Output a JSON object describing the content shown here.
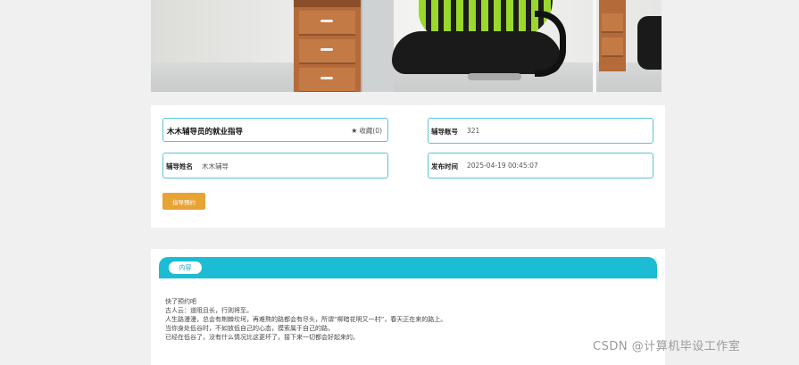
{
  "detail": {
    "title": "木木辅导员的就业指导",
    "favorite_label": "收藏(0)",
    "favorite_icon": "star-icon",
    "account_label": "辅导账号",
    "account_value": "321",
    "name_label": "辅导姓名",
    "name_value": "木木辅导",
    "time_label": "发布时间",
    "time_value": "2025-04-19 00:45:07",
    "reserve_button": "指导预约"
  },
  "content": {
    "tab_label": "内容",
    "lines": [
      "快了预约吧",
      "古人云：道阻且长，行则将至。",
      "人生路漫漫，总会有荆棘坎坷，再难熬的路都会有尽头，所谓“柳暗花明又一村”，春天正在来的路上。",
      "当你身处低谷时，不如放低自己的心态，摸索属于自己的路。",
      "已经在低谷了，没有什么情况比这更坏了，接下来一切都会好起来的。"
    ]
  },
  "watermark": "CSDN @计算机毕设工作室",
  "colors": {
    "accent": "#1bbcd4",
    "field_border": "#5bc4d6",
    "button": "#e8a335",
    "page_bg": "#f0f0f0"
  }
}
